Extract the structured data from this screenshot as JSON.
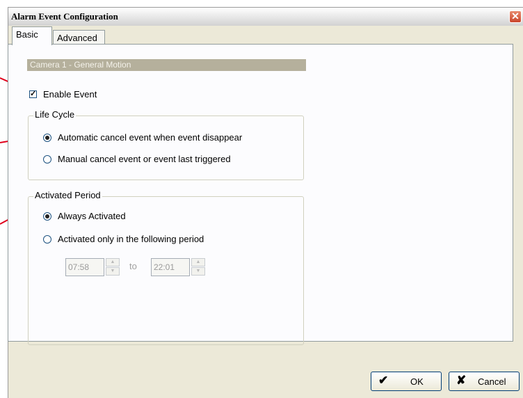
{
  "window": {
    "title": "Alarm Event Configuration",
    "close_glyph": "✕"
  },
  "tabs": [
    {
      "label": "Basic"
    },
    {
      "label": "Advanced"
    }
  ],
  "camera_header": "Camera 1 - General Motion",
  "enable_event": {
    "label": "Enable Event",
    "checked": true,
    "check_glyph": "✓"
  },
  "life_cycle": {
    "title": "Life Cycle",
    "options": [
      {
        "label": "Automatic cancel event when event disappear",
        "selected": true
      },
      {
        "label": "Manual cancel event or event last triggered",
        "selected": false
      }
    ]
  },
  "activated_period": {
    "title": "Activated Period",
    "options": [
      {
        "label": "Always Activated",
        "selected": true
      },
      {
        "label": "Activated only in the following period",
        "selected": false
      }
    ],
    "from_time": "07:58",
    "to_label": "to",
    "to_time": "22:01",
    "spin_up": "▲",
    "spin_down": "▼"
  },
  "buttons": {
    "ok_label": "OK",
    "ok_icon": "✔",
    "cancel_label": "Cancel",
    "cancel_icon": "✘"
  },
  "colors": {
    "annotation_line": "#e0001b",
    "header_bar": "#b5b09c"
  }
}
